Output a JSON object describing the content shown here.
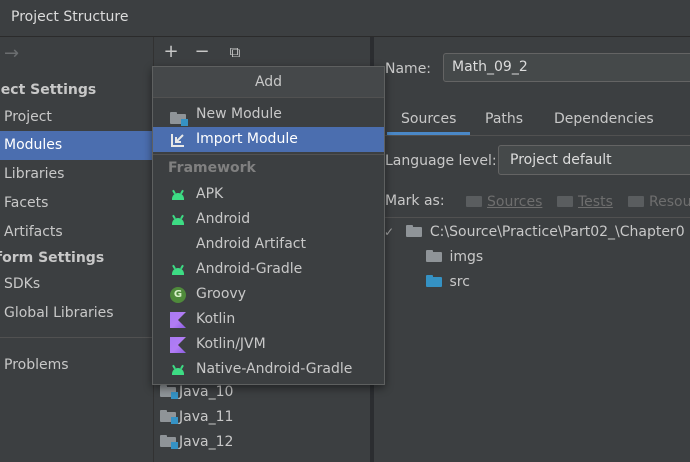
{
  "window": {
    "title": "Project Structure"
  },
  "sidebar": {
    "nav_arrow": "→",
    "project_settings_heading": "ject Settings",
    "project_settings_items": [
      {
        "label": "Project",
        "selected": false
      },
      {
        "label": "Modules",
        "selected": true
      },
      {
        "label": "Libraries",
        "selected": false
      },
      {
        "label": "Facets",
        "selected": false
      },
      {
        "label": "Artifacts",
        "selected": false
      }
    ],
    "platform_settings_heading": "form Settings",
    "platform_settings_items": [
      {
        "label": "SDKs"
      },
      {
        "label": "Global Libraries"
      }
    ],
    "problems_label": "Problems"
  },
  "modules_panel": {
    "toolbar": {
      "add": "+",
      "remove": "−",
      "copy": "⧉"
    },
    "modules": [
      {
        "label": "Java_10"
      },
      {
        "label": "Java_11"
      },
      {
        "label": "Java_12"
      }
    ]
  },
  "add_popup": {
    "header": "Add",
    "items": [
      {
        "label": "New Module",
        "icon": "folder-icon",
        "selected": false
      },
      {
        "label": "Import Module",
        "icon": "import-icon",
        "selected": true
      }
    ],
    "framework_heading": "Framework",
    "framework_items": [
      {
        "label": "APK",
        "icon": "android-icon"
      },
      {
        "label": "Android",
        "icon": "android-icon"
      },
      {
        "label": "Android Artifact",
        "icon": ""
      },
      {
        "label": "Android-Gradle",
        "icon": "android-icon"
      },
      {
        "label": "Groovy",
        "icon": "groovy-icon",
        "glyph": "G"
      },
      {
        "label": "Kotlin",
        "icon": "kotlin-icon"
      },
      {
        "label": "Kotlin/JVM",
        "icon": "kotlin-icon"
      },
      {
        "label": "Native-Android-Gradle",
        "icon": "android-icon"
      }
    ]
  },
  "detail": {
    "name_label": "Name:",
    "name_value": "Math_09_2",
    "tabs": [
      {
        "label": "Sources",
        "active": true
      },
      {
        "label": "Paths",
        "active": false
      },
      {
        "label": "Dependencies",
        "active": false
      }
    ],
    "language_level_label": "Language level:",
    "language_level_value": "Project default",
    "mark_as_label": "Mark as:",
    "mark_as_buttons": [
      "Sources",
      "Tests",
      "Resou"
    ],
    "tree": {
      "root": "C:\\Source\\Practice\\Part02_\\Chapter0",
      "children": [
        {
          "label": "imgs",
          "color": "#8f9498"
        },
        {
          "label": "src",
          "color": "#3592c4"
        }
      ]
    }
  }
}
